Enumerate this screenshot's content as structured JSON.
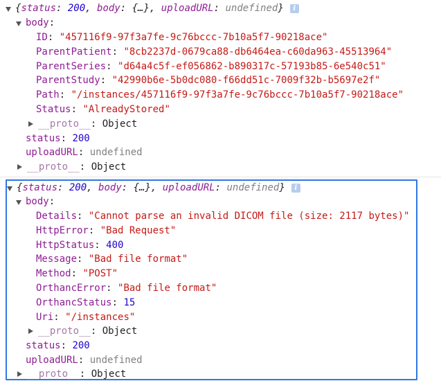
{
  "block1": {
    "summary": {
      "open": "{",
      "status_key": "status",
      "status_val": "200",
      "body_key": "body",
      "body_val": "{…}",
      "upload_key": "uploadURL",
      "upload_val": "undefined",
      "close": "}"
    },
    "info_glyph": "i",
    "body_label": "body",
    "fields": [
      {
        "key": "ID",
        "value": "\"457116f9-97f3a7fe-9c76bccc-7b10a5f7-90218ace\"",
        "kind": "string"
      },
      {
        "key": "ParentPatient",
        "value": "\"8cb2237d-0679ca88-db6464ea-c60da963-45513964\"",
        "kind": "string"
      },
      {
        "key": "ParentSeries",
        "value": "\"d64a4c5f-ef056862-b890317c-57193b85-6e540c51\"",
        "kind": "string"
      },
      {
        "key": "ParentStudy",
        "value": "\"42990b6e-5b0dc080-f66dd51c-7009f32b-b5697e2f\"",
        "kind": "string"
      },
      {
        "key": "Path",
        "value": "\"/instances/457116f9-97f3a7fe-9c76bccc-7b10a5f7-90218ace\"",
        "kind": "string"
      },
      {
        "key": "Status",
        "value": "\"AlreadyStored\"",
        "kind": "string"
      }
    ],
    "body_proto_key": "__proto__",
    "body_proto_val": "Object",
    "status_key": "status",
    "status_val": "200",
    "upload_key": "uploadURL",
    "upload_val": "undefined",
    "proto_key": "__proto__",
    "proto_val": "Object"
  },
  "block2": {
    "summary": {
      "open": "{",
      "status_key": "status",
      "status_val": "200",
      "body_key": "body",
      "body_val": "{…}",
      "upload_key": "uploadURL",
      "upload_val": "undefined",
      "close": "}"
    },
    "info_glyph": "i",
    "body_label": "body",
    "fields": [
      {
        "key": "Details",
        "value": "\"Cannot parse an invalid DICOM file (size: 2117 bytes)\"",
        "kind": "string"
      },
      {
        "key": "HttpError",
        "value": "\"Bad Request\"",
        "kind": "string"
      },
      {
        "key": "HttpStatus",
        "value": "400",
        "kind": "number"
      },
      {
        "key": "Message",
        "value": "\"Bad file format\"",
        "kind": "string"
      },
      {
        "key": "Method",
        "value": "\"POST\"",
        "kind": "string"
      },
      {
        "key": "OrthancError",
        "value": "\"Bad file format\"",
        "kind": "string"
      },
      {
        "key": "OrthancStatus",
        "value": "15",
        "kind": "number"
      },
      {
        "key": "Uri",
        "value": "\"/instances\"",
        "kind": "string"
      }
    ],
    "body_proto_key": "__proto__",
    "body_proto_val": "Object",
    "status_key": "status",
    "status_val": "200",
    "upload_key": "uploadURL",
    "upload_val": "undefined",
    "proto_key": "__proto__",
    "proto_val": "Object"
  },
  "colors": {
    "key": "#8e1d93",
    "string": "#c41a16",
    "number": "#1c00cf",
    "undefined": "#808080",
    "selection_border": "#2f76e4"
  }
}
